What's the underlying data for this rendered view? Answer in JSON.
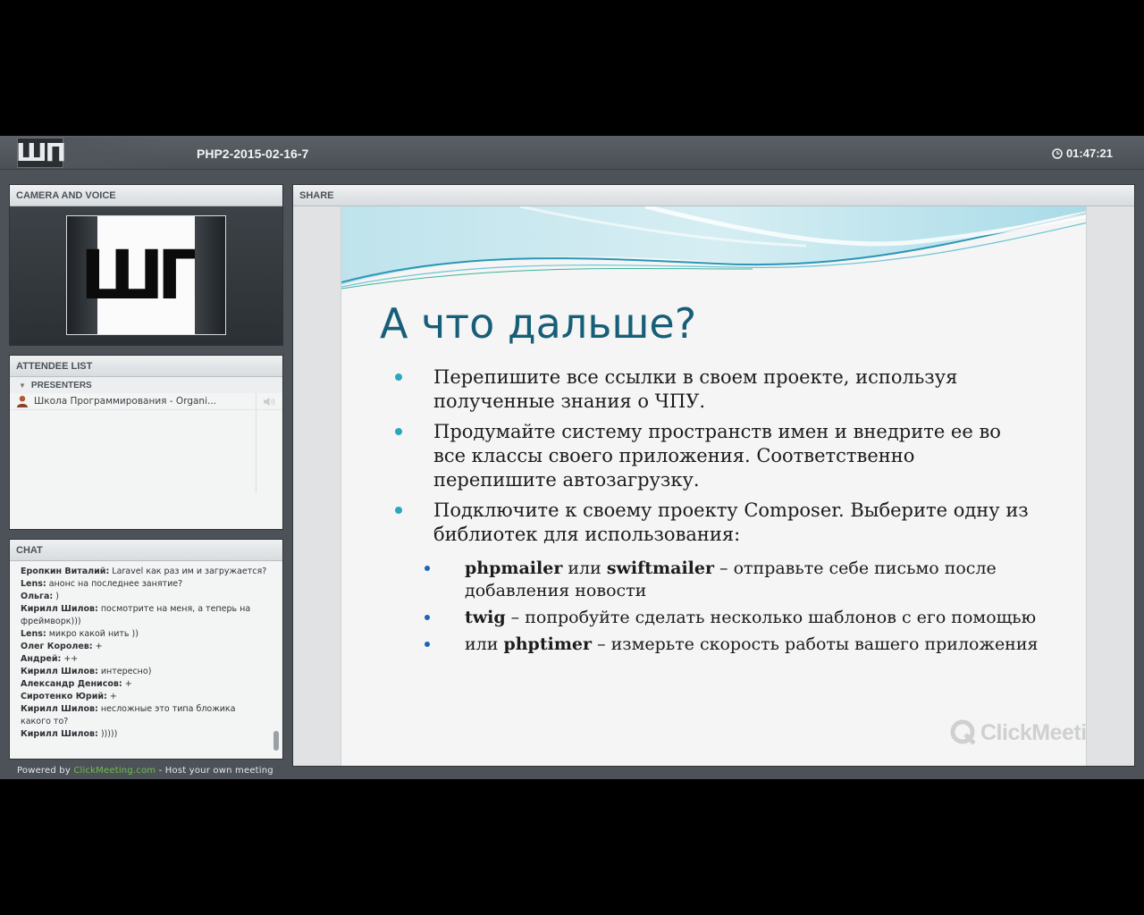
{
  "header": {
    "logo_text": "ШП",
    "meeting_title": "PHP2-2015-02-16-7",
    "timer": "01:47:21"
  },
  "camera": {
    "title": "CAMERA AND VOICE",
    "video_logo": "ШП"
  },
  "attendees": {
    "title": "ATTENDEE LIST",
    "group_label": "PRESENTERS",
    "items": [
      {
        "name": "Школа Программирования - Organi..."
      }
    ]
  },
  "chat": {
    "title": "CHAT",
    "messages": [
      {
        "author": "Еропкин Виталий:",
        "text": " Laravel как раз им и загружается?"
      },
      {
        "author": "Lens:",
        "text": " анонс на последнее занятие?"
      },
      {
        "author": "Ольга:",
        "text": " )"
      },
      {
        "author": "Кирилл Шилов:",
        "text": " посмотрите на меня, а теперь на фреймворк)))"
      },
      {
        "author": "Lens:",
        "text": " микро какой нить ))"
      },
      {
        "author": "Олег Королев:",
        "text": " +"
      },
      {
        "author": "Андрей:",
        "text": " ++"
      },
      {
        "author": "Кирилл Шилов:",
        "text": " интересно)"
      },
      {
        "author": "Александр Денисов:",
        "text": " +"
      },
      {
        "author": "Сиротенко Юрий:",
        "text": " +"
      },
      {
        "author": "Кирилл Шилов:",
        "text": " несложные это типа бложика какого то?"
      },
      {
        "author": "Кирилл Шилов:",
        "text": " )))))"
      }
    ]
  },
  "footer": {
    "prefix": "Powered by ",
    "link": "ClickMeeting.com",
    "suffix": " - Host your own meeting"
  },
  "share": {
    "title": "SHARE",
    "slide": {
      "heading": "А что дальше?",
      "bullets": [
        "Перепишите все ссылки в своем проекте, используя полученные знания о ЧПУ.",
        "Продумайте систему пространств имен и внедрите ее во все классы своего приложения. Соответственно перепишите автозагрузку.",
        "Подключите к своему проекту Composer. Выберите одну из библиотек для использования:"
      ],
      "sub_bullets": [
        {
          "b1": "phpmailer",
          "mid": " или ",
          "b2": "swiftmailer",
          "text": " – отправьте себе письмо после добавления новости"
        },
        {
          "b1": "twig",
          "mid": "",
          "b2": "",
          "text": " – попробуйте сделать несколько шаблонов с его помощью"
        },
        {
          "b1": "",
          "mid": "или ",
          "b2": "phptimer",
          "text": " – измерьте скорость работы вашего приложения"
        }
      ],
      "watermark": "ClickMeeting"
    }
  },
  "colors": {
    "accent_link": "#6ec04a",
    "slide_heading": "#175e78",
    "bullet_primary": "#2aa7c1",
    "bullet_secondary": "#1f63b7"
  }
}
